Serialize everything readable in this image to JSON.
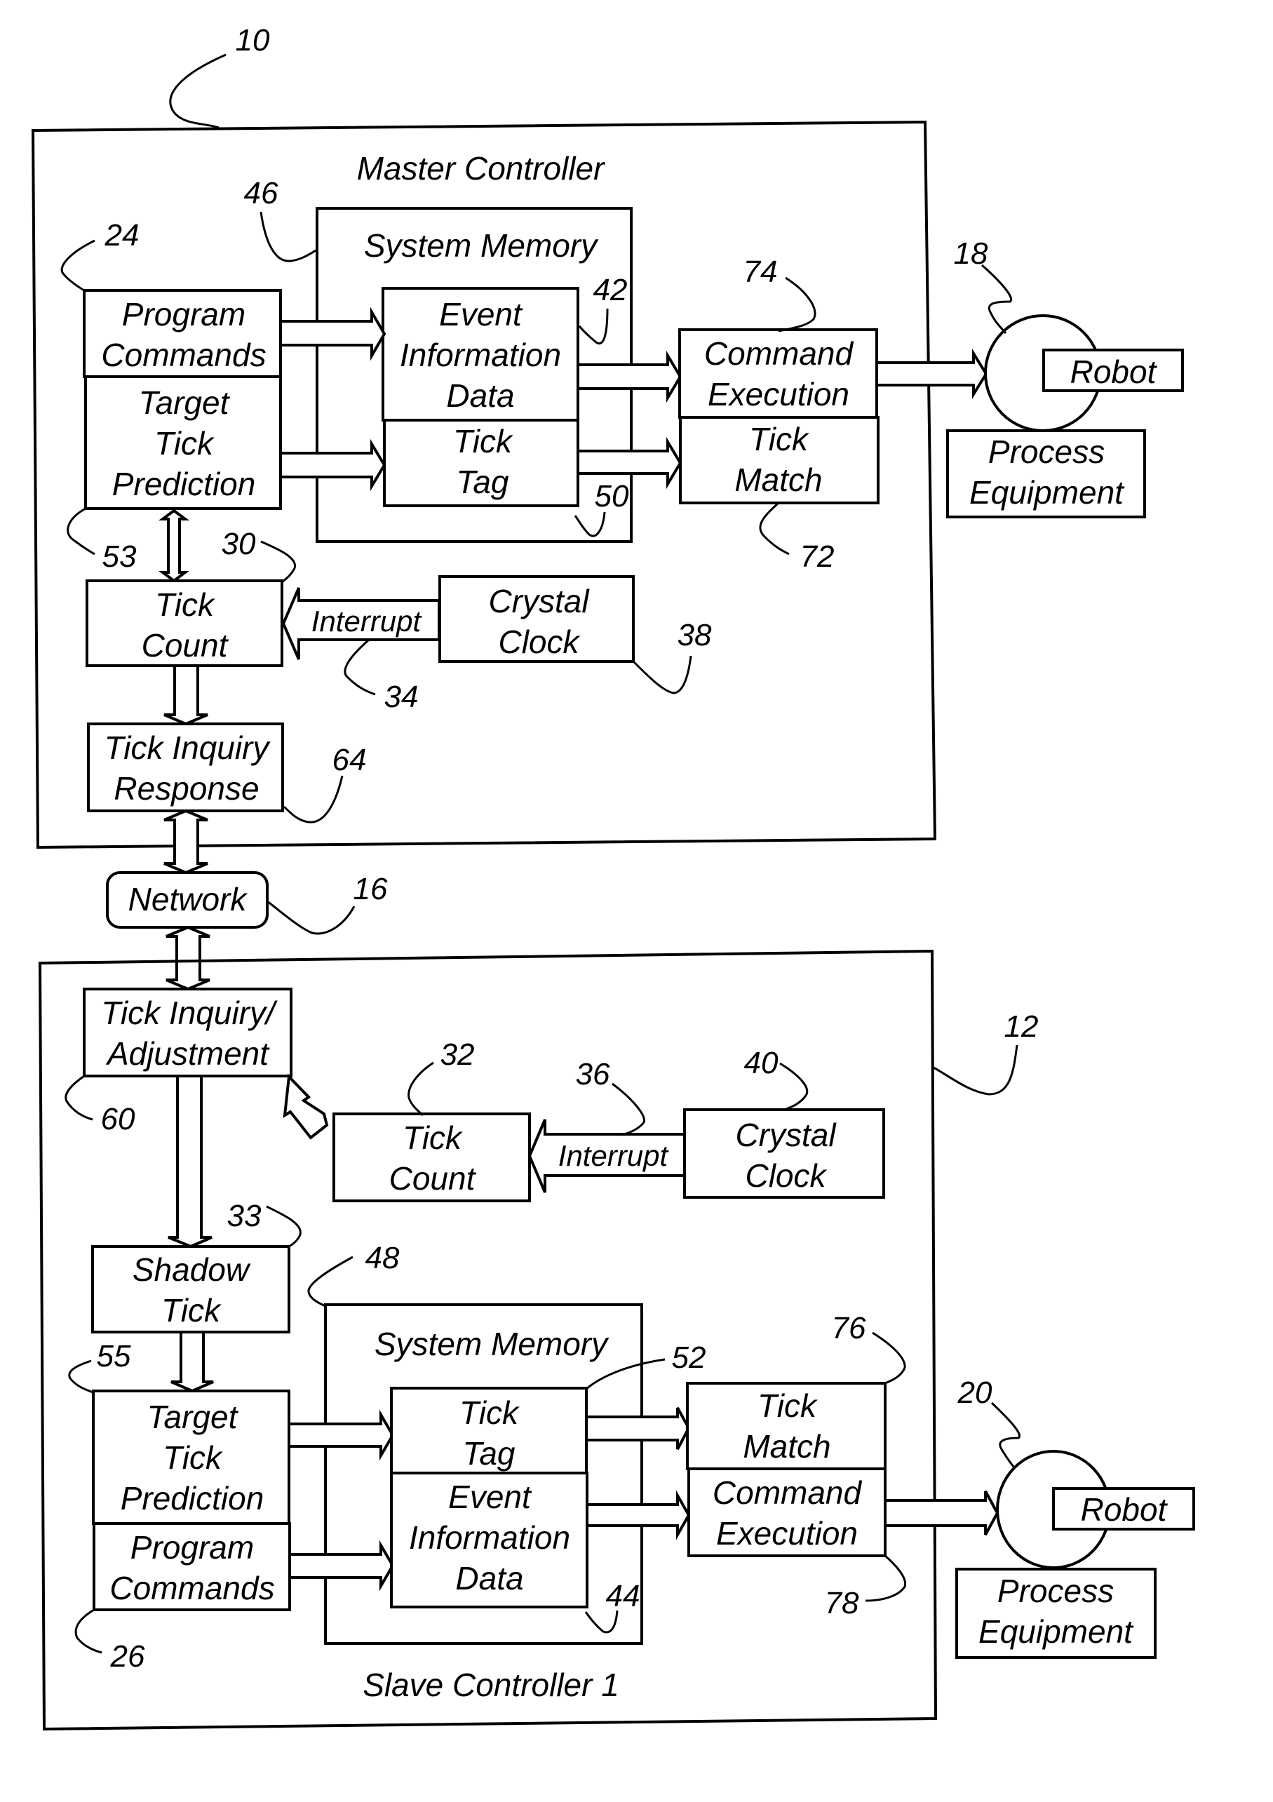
{
  "figure": {
    "ref": "10",
    "master": {
      "ref": "10",
      "title": "Master Controller",
      "program_commands": [
        "Program",
        "Commands"
      ],
      "program_commands_ref": "24",
      "target_tick": [
        "Target",
        "Tick",
        "Prediction"
      ],
      "target_tick_ref": "53",
      "system_memory": "System Memory",
      "system_memory_ref": "46",
      "event_info": [
        "Event",
        "Information",
        "Data"
      ],
      "event_info_ref": "42",
      "tick_tag": [
        "Tick",
        "Tag"
      ],
      "tick_tag_ref": "50",
      "command_exec": [
        "Command",
        "Execution"
      ],
      "command_exec_ref": "74",
      "tick_match": [
        "Tick",
        "Match"
      ],
      "tick_match_ref": "72",
      "tick_count": [
        "Tick",
        "Count"
      ],
      "tick_count_ref": "30",
      "interrupt": "Interrupt",
      "interrupt_ref": "34",
      "crystal_clock": [
        "Crystal",
        "Clock"
      ],
      "crystal_clock_ref": "38",
      "tick_inquiry": [
        "Tick Inquiry",
        "Response"
      ],
      "tick_inquiry_ref": "64",
      "robot": "Robot",
      "process_equipment": [
        "Process",
        "Equipment"
      ],
      "equipment_ref": "18"
    },
    "network": {
      "label": "Network",
      "ref": "16"
    },
    "slave": {
      "ref": "12",
      "title": "Slave Controller 1",
      "tick_inquiry": [
        "Tick Inquiry/",
        "Adjustment"
      ],
      "tick_inquiry_ref": "60",
      "tick_count": [
        "Tick",
        "Count"
      ],
      "tick_count_ref": "32",
      "interrupt": "Interrupt",
      "interrupt_ref": "36",
      "crystal_clock": [
        "Crystal",
        "Clock"
      ],
      "crystal_clock_ref": "40",
      "shadow_tick": [
        "Shadow",
        "Tick"
      ],
      "shadow_tick_ref": "33",
      "system_memory": "System Memory",
      "system_memory_ref": "48",
      "target_tick": [
        "Target",
        "Tick",
        "Prediction"
      ],
      "target_tick_ref": "55",
      "program_commands": [
        "Program",
        "Commands"
      ],
      "program_commands_ref": "26",
      "tick_tag": [
        "Tick",
        "Tag"
      ],
      "tick_tag_ref": "52",
      "event_info": [
        "Event",
        "Information",
        "Data"
      ],
      "event_info_ref": "44",
      "tick_match": [
        "Tick",
        "Match"
      ],
      "tick_match_ref": "76",
      "command_exec": [
        "Command",
        "Execution"
      ],
      "command_exec_ref": "78",
      "robot": "Robot",
      "process_equipment": [
        "Process",
        "Equipment"
      ],
      "equipment_ref": "20"
    }
  }
}
